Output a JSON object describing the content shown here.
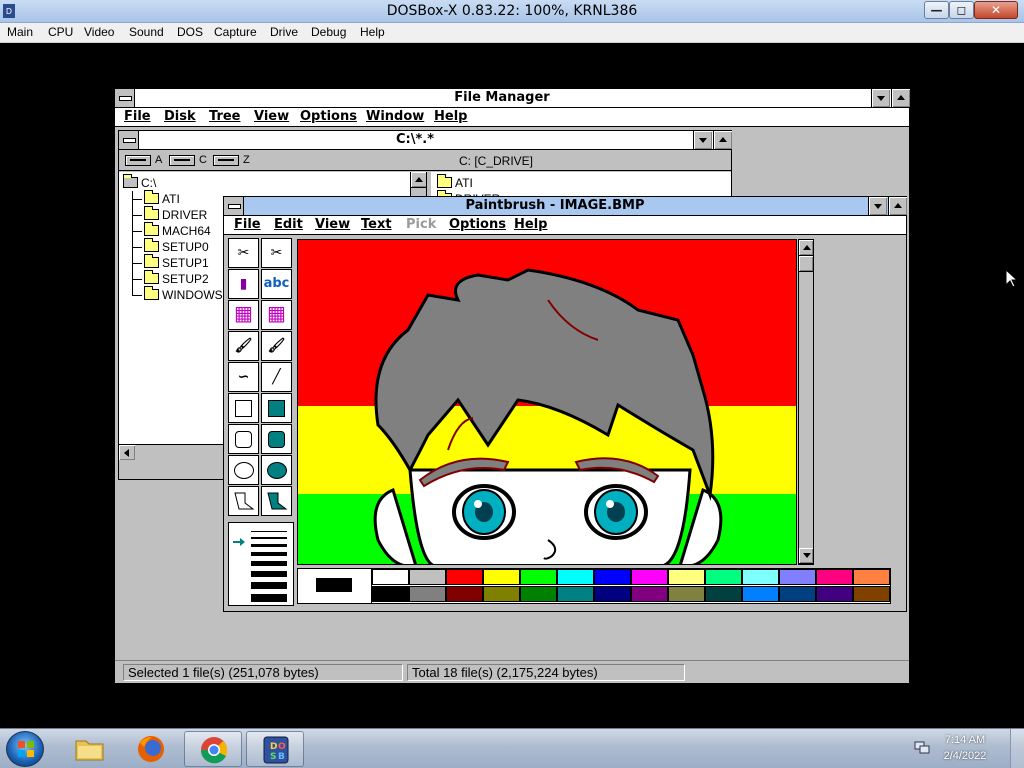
{
  "host": {
    "title": "DOSBox-X 0.83.22: 100%, KRNL386",
    "menu": [
      "Main",
      "CPU",
      "Video",
      "Sound",
      "DOS",
      "Capture",
      "Drive",
      "Debug",
      "Help"
    ],
    "min_glyph": "—",
    "max_glyph": "◻",
    "close_glyph": "✕"
  },
  "file_manager": {
    "title": "File Manager",
    "menu": [
      "File",
      "Disk",
      "Tree",
      "View",
      "Options",
      "Window",
      "Help"
    ],
    "dir_window_title": "C:\\*.*",
    "drives": [
      "A",
      "C",
      "Z"
    ],
    "drive_label": "C: [C_DRIVE]",
    "tree": {
      "root": "C:\\",
      "folders": [
        "ATI",
        "DRIVER",
        "MACH64",
        "SETUP0",
        "SETUP1",
        "SETUP2",
        "WINDOWS"
      ]
    },
    "dir_items": [
      "ATI",
      "DRIVER"
    ],
    "status_selected": "Selected 1 file(s) (251,078 bytes)",
    "status_total": "Total 18 file(s) (2,175,224 bytes)"
  },
  "paintbrush": {
    "title": "Paintbrush - IMAGE.BMP",
    "menu": [
      {
        "label": "File",
        "enabled": true
      },
      {
        "label": "Edit",
        "enabled": true
      },
      {
        "label": "View",
        "enabled": true
      },
      {
        "label": "Text",
        "enabled": true
      },
      {
        "label": "Pick",
        "enabled": false
      },
      {
        "label": "Options",
        "enabled": true
      },
      {
        "label": "Help",
        "enabled": true
      }
    ],
    "tools": [
      {
        "name": "scissors-tool",
        "glyph": "✂"
      },
      {
        "name": "pick-tool",
        "glyph": "✂"
      },
      {
        "name": "airbrush-tool",
        "glyph": "▮"
      },
      {
        "name": "text-tool",
        "glyph": "abc"
      },
      {
        "name": "color-eraser-tool",
        "glyph": "▦"
      },
      {
        "name": "eraser-tool",
        "glyph": "▦"
      },
      {
        "name": "paint-roller-tool",
        "glyph": "🖌"
      },
      {
        "name": "brush-tool",
        "glyph": "🖌"
      },
      {
        "name": "curve-tool",
        "glyph": "∽"
      },
      {
        "name": "line-tool",
        "glyph": "╱"
      },
      {
        "name": "box-tool",
        "glyph": "box-o"
      },
      {
        "name": "filled-box-tool",
        "glyph": "box-f"
      },
      {
        "name": "rounded-box-tool",
        "glyph": "rbox-o"
      },
      {
        "name": "filled-rounded-box-tool",
        "glyph": "rbox-f"
      },
      {
        "name": "circle-tool",
        "glyph": "circ-o"
      },
      {
        "name": "filled-circle-tool",
        "glyph": "circ-f"
      },
      {
        "name": "polygon-tool",
        "glyph": "poly-o"
      },
      {
        "name": "filled-polygon-tool",
        "glyph": "poly-f"
      }
    ],
    "line_sizes": [
      1,
      2,
      3,
      4,
      5,
      6,
      7,
      8
    ],
    "selected_fg": "#000000",
    "selected_bg": "#ffffff",
    "palette_top": [
      "#ffffff",
      "#c0c0c0",
      "#ff0000",
      "#ffff00",
      "#00ff00",
      "#00ffff",
      "#0000ff",
      "#ff00ff",
      "#ffff80",
      "#00ff80",
      "#80ffff",
      "#8080ff",
      "#ff0080",
      "#ff8040"
    ],
    "palette_bottom": [
      "#000000",
      "#808080",
      "#800000",
      "#808000",
      "#008000",
      "#008080",
      "#000080",
      "#800080",
      "#808040",
      "#004040",
      "#0080ff",
      "#004080",
      "#400080",
      "#804000"
    ]
  },
  "taskbar": {
    "items": [
      "start-button",
      "explorer",
      "firefox",
      "chrome",
      "dosbox"
    ],
    "time": "7:14 AM",
    "date": "2/4/2022"
  }
}
